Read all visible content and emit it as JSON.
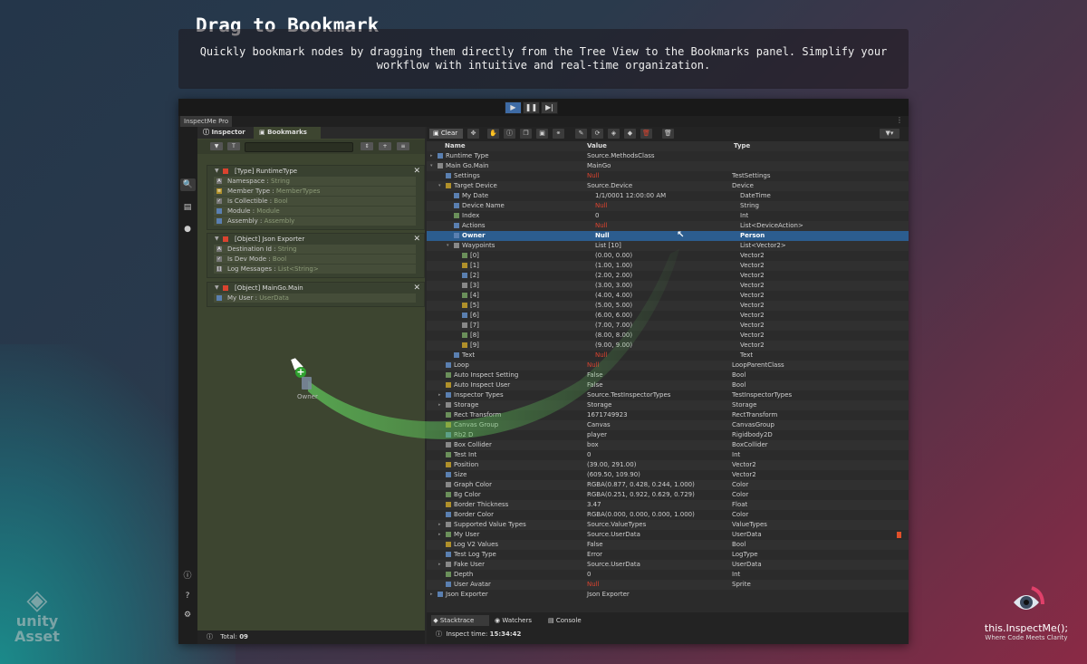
{
  "hero": {
    "title": "Drag to Bookmark",
    "description": "Quickly bookmark nodes by dragging them directly from the Tree View to the Bookmarks panel. Simplify your workflow with intuitive and real-time organization."
  },
  "window": {
    "tab_title": "InspectMe Pro",
    "menu_glyph": "⋮"
  },
  "left_panel": {
    "tabs": [
      {
        "label": "Inspector"
      },
      {
        "label": "Bookmarks"
      }
    ],
    "cards": [
      {
        "title": "[Type] RuntimeType",
        "rows": [
          {
            "name": "Namespace",
            "type": "String"
          },
          {
            "name": "Member Type",
            "type": "MemberTypes"
          },
          {
            "name": "Is Collectible",
            "type": "Bool"
          },
          {
            "name": "Module",
            "type": "Module"
          },
          {
            "name": "Assembly",
            "type": "Assembly"
          }
        ]
      },
      {
        "title": "[Object] Json Exporter",
        "rows": [
          {
            "name": "Destination Id",
            "type": "String"
          },
          {
            "name": "Is Dev Mode",
            "type": "Bool"
          },
          {
            "name": "Log Messages",
            "type": "List<String>"
          }
        ]
      },
      {
        "title": "[Object] MainGo.Main",
        "rows": [
          {
            "name": "My User",
            "type": "UserData"
          }
        ]
      }
    ],
    "footer": {
      "total_label": "Total:",
      "total": "09"
    }
  },
  "drag": {
    "label": "Owner"
  },
  "right_panel": {
    "clear_label": "Clear",
    "columns": {
      "name": "Name",
      "value": "Value",
      "type": "Type"
    },
    "rows": [
      {
        "name": "Runtime Type",
        "value": "Source.MethodsClass",
        "type": "",
        "lvl": 0,
        "exp": "▸"
      },
      {
        "name": "Main Go.Main",
        "value": "MainGo",
        "type": "",
        "lvl": 0,
        "exp": "▾"
      },
      {
        "name": "Settings",
        "value": "Null",
        "type": "TestSettings",
        "lvl": 1,
        "null": true
      },
      {
        "name": "Target Device",
        "value": "Source.Device",
        "type": "Device",
        "lvl": 1,
        "exp": "▾"
      },
      {
        "name": "My Date",
        "value": "1/1/0001 12:00:00 AM",
        "type": "DateTime",
        "lvl": 2
      },
      {
        "name": "Device Name",
        "value": "Null",
        "type": "String",
        "lvl": 2,
        "null": true
      },
      {
        "name": "Index",
        "value": "0",
        "type": "Int",
        "lvl": 2
      },
      {
        "name": "Actions",
        "value": "Null",
        "type": "List<DeviceAction>",
        "lvl": 2,
        "null": true
      },
      {
        "name": "Owner",
        "value": "Null",
        "type": "Person",
        "lvl": 2,
        "null": true,
        "sel": true
      },
      {
        "name": "Waypoints",
        "value": "List [10]",
        "type": "List<Vector2>",
        "lvl": 2,
        "exp": "▾"
      },
      {
        "name": "[0]",
        "value": "(0.00, 0.00)",
        "type": "Vector2",
        "lvl": 3
      },
      {
        "name": "[1]",
        "value": "(1.00, 1.00)",
        "type": "Vector2",
        "lvl": 3
      },
      {
        "name": "[2]",
        "value": "(2.00, 2.00)",
        "type": "Vector2",
        "lvl": 3
      },
      {
        "name": "[3]",
        "value": "(3.00, 3.00)",
        "type": "Vector2",
        "lvl": 3
      },
      {
        "name": "[4]",
        "value": "(4.00, 4.00)",
        "type": "Vector2",
        "lvl": 3
      },
      {
        "name": "[5]",
        "value": "(5.00, 5.00)",
        "type": "Vector2",
        "lvl": 3
      },
      {
        "name": "[6]",
        "value": "(6.00, 6.00)",
        "type": "Vector2",
        "lvl": 3
      },
      {
        "name": "[7]",
        "value": "(7.00, 7.00)",
        "type": "Vector2",
        "lvl": 3
      },
      {
        "name": "[8]",
        "value": "(8.00, 8.00)",
        "type": "Vector2",
        "lvl": 3
      },
      {
        "name": "[9]",
        "value": "(9.00, 9.00)",
        "type": "Vector2",
        "lvl": 3
      },
      {
        "name": "Text",
        "value": "Null",
        "type": "Text",
        "lvl": 2,
        "null": true
      },
      {
        "name": "Loop",
        "value": "Null",
        "type": "LoopParentClass",
        "lvl": 1,
        "null": true
      },
      {
        "name": "Auto Inspect Setting",
        "value": "False",
        "type": "Bool",
        "lvl": 1
      },
      {
        "name": "Auto Inspect User",
        "value": "False",
        "type": "Bool",
        "lvl": 1
      },
      {
        "name": "Inspector Types",
        "value": "Source.TestInspectorTypes",
        "type": "TestInspectorTypes",
        "lvl": 1,
        "exp": "▸"
      },
      {
        "name": "Storage",
        "value": "Storage",
        "type": "Storage",
        "lvl": 1,
        "exp": "▸"
      },
      {
        "name": "Rect Transform",
        "value": "1671749923",
        "type": "RectTransform",
        "lvl": 1
      },
      {
        "name": "Canvas Group",
        "value": "Canvas",
        "type": "CanvasGroup",
        "lvl": 1
      },
      {
        "name": "Rb2 D",
        "value": "player",
        "type": "Rigidbody2D",
        "lvl": 1
      },
      {
        "name": "Box Collider",
        "value": "box",
        "type": "BoxCollider",
        "lvl": 1
      },
      {
        "name": "Test Int",
        "value": "0",
        "type": "Int",
        "lvl": 1
      },
      {
        "name": "Position",
        "value": "(39.00, 291.00)",
        "type": "Vector2",
        "lvl": 1
      },
      {
        "name": "Size",
        "value": "(609.50, 109.90)",
        "type": "Vector2",
        "lvl": 1
      },
      {
        "name": "Graph Color",
        "value": "RGBA(0.877, 0.428, 0.244, 1.000)",
        "type": "Color",
        "lvl": 1
      },
      {
        "name": "Bg Color",
        "value": "RGBA(0.251, 0.922, 0.629, 0.729)",
        "type": "Color",
        "lvl": 1
      },
      {
        "name": "Border Thickness",
        "value": "3.47",
        "type": "Float",
        "lvl": 1
      },
      {
        "name": "Border Color",
        "value": "RGBA(0.000, 0.000, 0.000, 1.000)",
        "type": "Color",
        "lvl": 1
      },
      {
        "name": "Supported Value Types",
        "value": "Source.ValueTypes",
        "type": "ValueTypes",
        "lvl": 1,
        "exp": "▸"
      },
      {
        "name": "My User",
        "value": "Source.UserData",
        "type": "UserData",
        "lvl": 1,
        "exp": "▸",
        "bm": true
      },
      {
        "name": "Log V2 Values",
        "value": "False",
        "type": "Bool",
        "lvl": 1
      },
      {
        "name": "Test Log Type",
        "value": "Error",
        "type": "LogType",
        "lvl": 1
      },
      {
        "name": "Fake User",
        "value": "Source.UserData",
        "type": "UserData",
        "lvl": 1,
        "exp": "▸"
      },
      {
        "name": "Depth",
        "value": "0",
        "type": "Int",
        "lvl": 1
      },
      {
        "name": "User Avatar",
        "value": "Null",
        "type": "Sprite",
        "lvl": 1,
        "null": true
      },
      {
        "name": "Json Exporter",
        "value": "Json Exporter",
        "type": "",
        "lvl": 0,
        "exp": "▸"
      }
    ],
    "footer_tabs": [
      {
        "label": "Stacktrace"
      },
      {
        "label": "Watchers"
      },
      {
        "label": "Console"
      }
    ],
    "inspect_label": "Inspect time:",
    "inspect_time": "15:34:42"
  },
  "unity": {
    "line1": "unity",
    "line2": "Asset"
  },
  "brand": {
    "name": "this.InspectMe();",
    "tagline": "Where Code Meets Clarity"
  },
  "colors": {
    "accent": "#3e6ba5",
    "selected_row": "#2c5d8f",
    "null": "#d9432f",
    "bookmark_panel": "#3d4530"
  }
}
